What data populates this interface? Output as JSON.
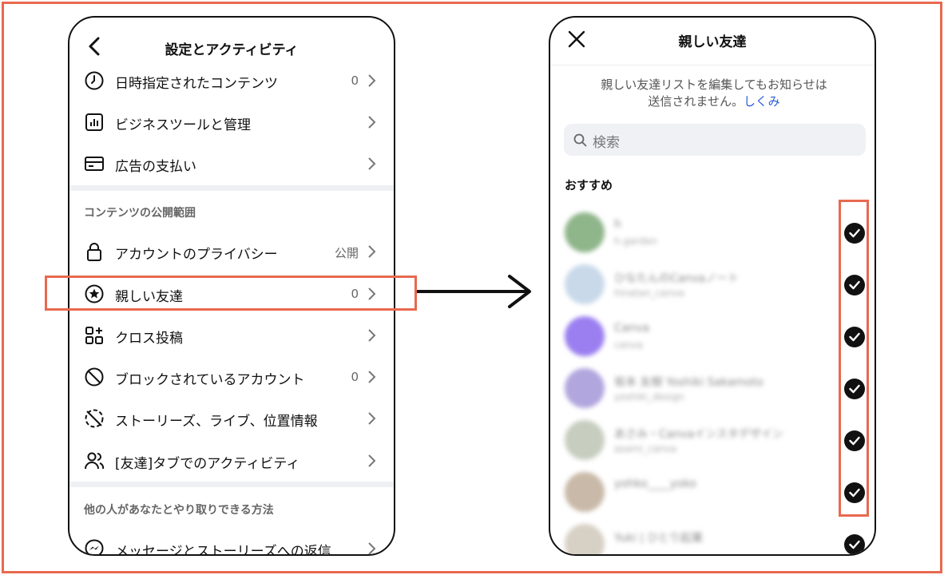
{
  "settings": {
    "title": "設定とアクティビティ",
    "items_top": [
      {
        "label": "日時指定されたコンテンツ",
        "value": "0",
        "icon": "clock-icon"
      },
      {
        "label": "ビジネスツールと管理",
        "value": "",
        "icon": "chart-icon"
      },
      {
        "label": "広告の支払い",
        "value": "",
        "icon": "card-icon"
      }
    ],
    "section1": "コンテンツの公開範囲",
    "items_mid": [
      {
        "label": "アカウントのプライバシー",
        "value": "公開",
        "icon": "lock-icon"
      },
      {
        "label": "親しい友達",
        "value": "0",
        "icon": "star-circle-icon"
      },
      {
        "label": "クロス投稿",
        "value": "",
        "icon": "grid-plus-icon"
      },
      {
        "label": "ブロックされているアカウント",
        "value": "0",
        "icon": "block-icon"
      },
      {
        "label": "ストーリーズ、ライブ、位置情報",
        "value": "",
        "icon": "story-off-icon"
      },
      {
        "label": "[友達]タブでのアクティビティ",
        "value": "",
        "icon": "friends-icon"
      }
    ],
    "section2": "他の人があなたとやり取りできる方法",
    "items_bottom": [
      {
        "label": "メッセージとストーリーズへの返信",
        "value": "",
        "icon": "messenger-icon"
      }
    ]
  },
  "close_friends": {
    "title": "親しい友達",
    "notice_line1": "親しい友達リストを編集してもお知らせは",
    "notice_line2": "送信されません。",
    "notice_link": "しくみ",
    "search_placeholder": "検索",
    "recommended_label": "おすすめ",
    "friends": [
      {
        "name": "h",
        "sub": "h.garden",
        "color": "#8fb58a"
      },
      {
        "name": "ひなたんのCanvaノート",
        "sub": "hinatan_canva",
        "color": "#c9d9ea"
      },
      {
        "name": "Canva",
        "sub": "canva",
        "color": "#9b7ff0"
      },
      {
        "name": "坂本 友樹 Yoshiki Sakamoto",
        "sub": "yoshiki_design",
        "color": "#b2a6de"
      },
      {
        "name": "あさみ・Canvaインスタデザイン",
        "sub": "asami_canva",
        "color": "#c7cec0"
      },
      {
        "name": "yohko____yoko",
        "sub": "",
        "color": "#c9b9a8"
      },
      {
        "name": "Yuki | ひとり起業",
        "sub": "",
        "color": "#d7d0c5"
      }
    ]
  }
}
